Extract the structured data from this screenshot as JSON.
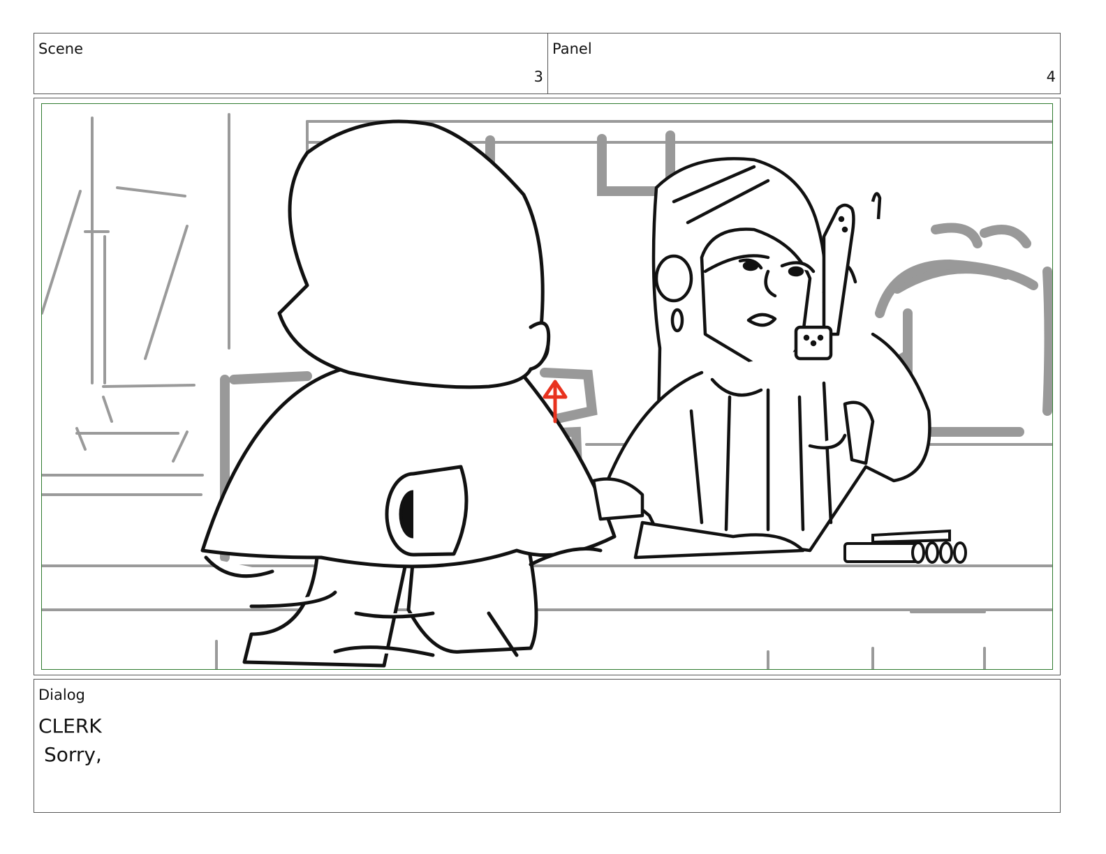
{
  "header": {
    "scene_label": "Scene",
    "scene_number": "3",
    "panel_label": "Panel",
    "panel_number": "4"
  },
  "frame": {
    "border_color": "#2e7a2e",
    "annotation_color": "#e8321e",
    "description_icon": "storyboard-sketch"
  },
  "dialog": {
    "label": "Dialog",
    "speaker": "CLERK",
    "line": "Sorry,"
  }
}
